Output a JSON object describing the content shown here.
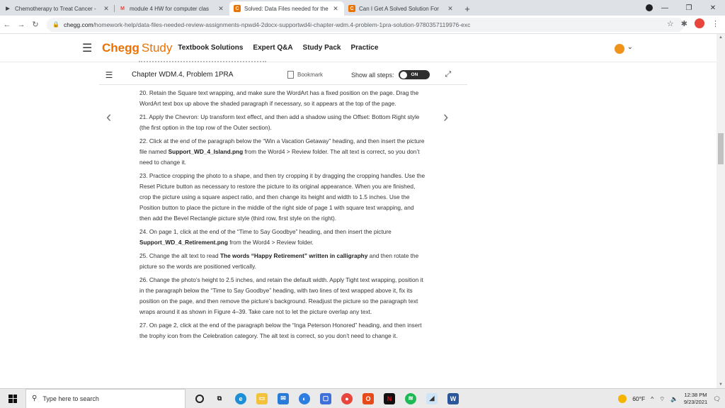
{
  "browser": {
    "tabs": [
      {
        "title": "Chemotherapy to Treat Cancer -",
        "icon": "play-icon",
        "color": "#333333"
      },
      {
        "title": "module 4 HW for computer clas",
        "icon": "gmail-icon",
        "color": "#ea4335"
      },
      {
        "title": "Solved: Data Files needed for the",
        "icon": "chegg-icon",
        "color": "#eb7100",
        "active": true
      },
      {
        "title": "Can I Get A Solved Solution For",
        "icon": "chegg-icon",
        "color": "#eb7100"
      }
    ],
    "url_domain": "chegg.com",
    "url_path": "/homework-help/data-files-needed-review-assignments-npwd4-2docx-supportwd4i-chapter-wdm.4-problem-1pra-solution-9780357119976-exc"
  },
  "header": {
    "logo_main": "Chegg",
    "logo_sub": "Study",
    "nav": [
      "Textbook Solutions",
      "Expert Q&A",
      "Study Pack",
      "Practice"
    ]
  },
  "problem": {
    "title": "Chapter WDM.4, Problem 1PRA",
    "bookmark_label": "Bookmark",
    "show_steps_label": "Show all steps:",
    "toggle_label": "ON"
  },
  "content": {
    "p20": "20. Retain the Square text wrapping, and make sure the WordArt has a fixed position on the page. Drag the WordArt text box up above the shaded paragraph if necessary, so it appears at the top of the page.",
    "p21": "21. Apply the Chevron: Up transform text effect, and then add a shadow using the Offset: Bottom Right style (the first option in the top row of the Outer section).",
    "p22a": "22. Click at the end of the paragraph below the “Win a Vacation Getaway” heading, and then insert the picture file named ",
    "p22b": "Support_WD_4_Island.png",
    "p22c": " from the Word4 > Review folder. The alt text is correct, so you don’t need to change it.",
    "p23": "23. Practice cropping the photo to a shape, and then try cropping it by dragging the cropping handles. Use the Reset Picture button as necessary to restore the picture to its original appearance. When you are finished, crop the picture using a square aspect ratio, and then change its height and width to 1.5 inches. Use the Position button to place the picture in the middle of the right side of page 1 with square text wrapping, and then add the Bevel Rectangle picture style (third row, first style on the right).",
    "p24a": "24. On page 1, click at the end of the “Time to Say Goodbye” heading, and then insert the picture ",
    "p24b": "Support_WD_4_Retirement.png",
    "p24c": " from the Word4 > Review folder.",
    "p25a": "25. Change the alt text to read ",
    "p25b": "The words “Happy Retirement” written in calligraphy",
    "p25c": " and then rotate the picture so the words are positioned vertically.",
    "p26": "26. Change the photo’s height to 2.5 inches, and retain the default width. Apply Tight text wrapping, position it in the paragraph below the “Time to Say Goodbye” heading, with two lines of text wrapped above it, fix its position on the page, and then remove the picture’s background. Readjust the picture so the paragraph text wraps around it as shown in Figure 4–39. Take care not to let the picture overlap any text.",
    "p27": "27. On page 2, click at the end of the paragraph below the “Inga Peterson Honored” heading, and then insert the trophy icon from the Celebration category. The alt text is correct, so you don’t need to change it."
  },
  "taskbar": {
    "search_placeholder": "Type here to search",
    "weather": "60°F",
    "time": "12:38 PM",
    "date": "9/23/2021"
  }
}
